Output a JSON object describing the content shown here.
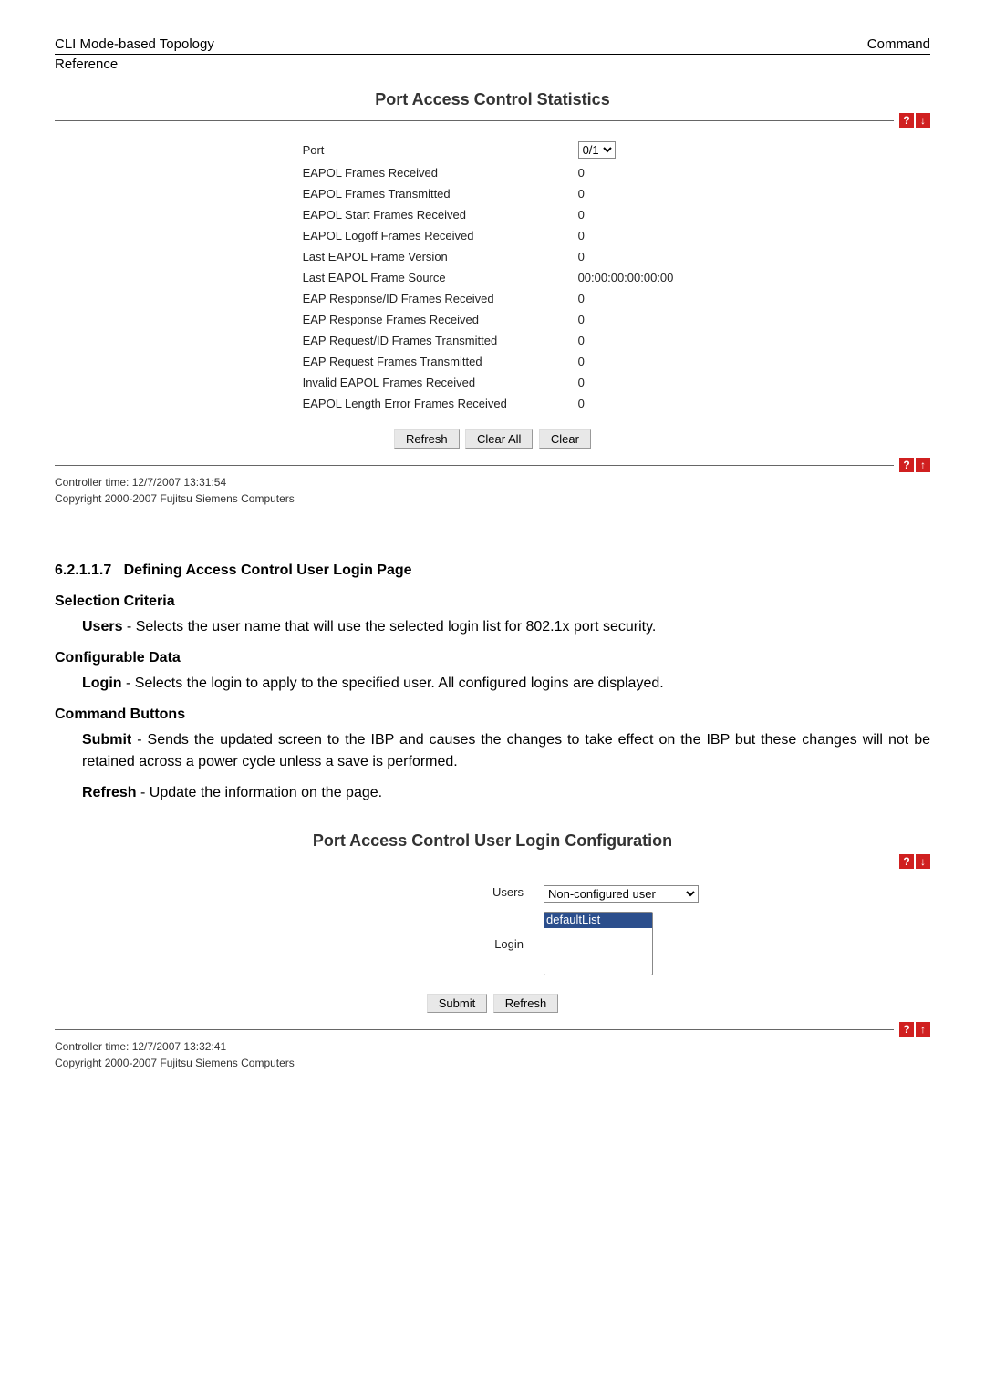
{
  "header": {
    "left": "CLI  Mode-based  Topology",
    "right": "Command",
    "sub": "Reference"
  },
  "panel1": {
    "title": "Port Access Control Statistics",
    "port_label": "Port",
    "port_value": "0/1",
    "rows": [
      {
        "label": "EAPOL Frames Received",
        "value": "0"
      },
      {
        "label": "EAPOL Frames Transmitted",
        "value": "0"
      },
      {
        "label": "EAPOL Start Frames Received",
        "value": "0"
      },
      {
        "label": "EAPOL Logoff Frames Received",
        "value": "0"
      },
      {
        "label": "Last EAPOL Frame Version",
        "value": "0"
      },
      {
        "label": "Last EAPOL Frame Source",
        "value": "00:00:00:00:00:00"
      },
      {
        "label": "EAP Response/ID Frames Received",
        "value": "0"
      },
      {
        "label": "EAP Response Frames Received",
        "value": "0"
      },
      {
        "label": "EAP Request/ID Frames Transmitted",
        "value": "0"
      },
      {
        "label": "EAP Request Frames Transmitted",
        "value": "0"
      },
      {
        "label": "Invalid EAPOL Frames Received",
        "value": "0"
      },
      {
        "label": "EAPOL Length Error Frames Received",
        "value": "0"
      }
    ],
    "buttons": {
      "refresh": "Refresh",
      "clear_all": "Clear All",
      "clear": "Clear"
    },
    "footer_time": "Controller time: 12/7/2007 13:31:54",
    "footer_copy": "Copyright 2000-2007 Fujitsu Siemens Computers"
  },
  "docsection": {
    "heading_num": "6.2.1.1.7",
    "heading_txt": "Defining Access Control User Login Page",
    "selcrit_h": "Selection Criteria",
    "selcrit_body_b": "Users",
    "selcrit_body": " - Selects the user name that will use the selected login list for 802.1x port security.",
    "confdata_h": "Configurable Data",
    "confdata_body_b": "Login",
    "confdata_body": " - Selects the login to apply to the specified user. All configured logins are displayed.",
    "cmdbtn_h": "Command Buttons",
    "cmd_submit_b": "Submit",
    "cmd_submit_body": " - Sends the updated screen to the IBP and causes the changes to take effect on the IBP but these changes will not be retained across a power cycle unless a save is performed.",
    "cmd_refresh_b": "Refresh",
    "cmd_refresh_body": " - Update the information on the page."
  },
  "panel2": {
    "title": "Port Access Control User Login Configuration",
    "users_label": "Users",
    "users_value": "Non-configured user",
    "login_label": "Login",
    "login_option": "defaultList",
    "buttons": {
      "submit": "Submit",
      "refresh": "Refresh"
    },
    "footer_time": "Controller time: 12/7/2007 13:32:41",
    "footer_copy": "Copyright 2000-2007 Fujitsu Siemens Computers"
  },
  "icons": {
    "help": "?",
    "down": "↓",
    "up": "↑"
  }
}
